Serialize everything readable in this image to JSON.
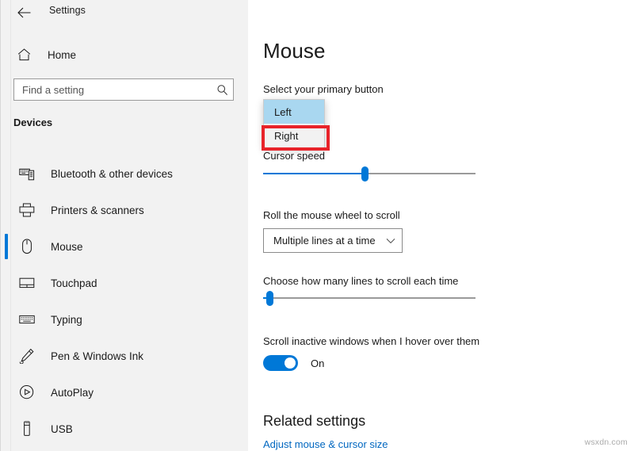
{
  "window": {
    "app_title": "Settings",
    "back_icon": "back-arrow-icon",
    "controls": {
      "minimize": "minimize-icon",
      "maximize": "maximize-icon",
      "close": "close-icon"
    }
  },
  "sidebar": {
    "home": {
      "label": "Home",
      "icon": "home-icon"
    },
    "search": {
      "placeholder": "Find a setting",
      "value": "",
      "icon": "search-icon"
    },
    "group_header": "Devices",
    "items": [
      {
        "label": "Bluetooth & other devices",
        "icon": "bluetooth-devices-icon",
        "selected": false
      },
      {
        "label": "Printers & scanners",
        "icon": "printer-icon",
        "selected": false
      },
      {
        "label": "Mouse",
        "icon": "mouse-icon",
        "selected": true
      },
      {
        "label": "Touchpad",
        "icon": "touchpad-icon",
        "selected": false
      },
      {
        "label": "Typing",
        "icon": "keyboard-icon",
        "selected": false
      },
      {
        "label": "Pen & Windows Ink",
        "icon": "pen-icon",
        "selected": false
      },
      {
        "label": "AutoPlay",
        "icon": "autoplay-icon",
        "selected": false
      },
      {
        "label": "USB",
        "icon": "usb-icon",
        "selected": false
      }
    ]
  },
  "main": {
    "page_title": "Mouse",
    "primary_button": {
      "label": "Select your primary button",
      "dropdown_open": true,
      "options": [
        {
          "label": "Left",
          "highlighted": true
        },
        {
          "label": "Right",
          "highlighted": false
        }
      ],
      "annotation": {
        "target": "Right",
        "color": "#e8232a"
      }
    },
    "cursor_speed": {
      "label": "Cursor speed",
      "value_percent": 48
    },
    "scroll_wheel": {
      "label": "Roll the mouse wheel to scroll",
      "selected": "Multiple lines at a time",
      "chevron": "chevron-down-icon"
    },
    "lines_to_scroll": {
      "label": "Choose how many lines to scroll each time",
      "value_percent": 3
    },
    "inactive_scroll": {
      "label": "Scroll inactive windows when I hover over them",
      "state": "On",
      "on": true
    },
    "related": {
      "title": "Related settings",
      "links": [
        {
          "label": "Adjust mouse & cursor size"
        }
      ]
    }
  },
  "watermark": "wsxdn.com",
  "colors": {
    "accent": "#0078d7",
    "annotation_red": "#e8232a",
    "highlight_blue": "#a9d7f0",
    "sidebar_bg": "#f2f2f2",
    "link": "#0067c0"
  }
}
